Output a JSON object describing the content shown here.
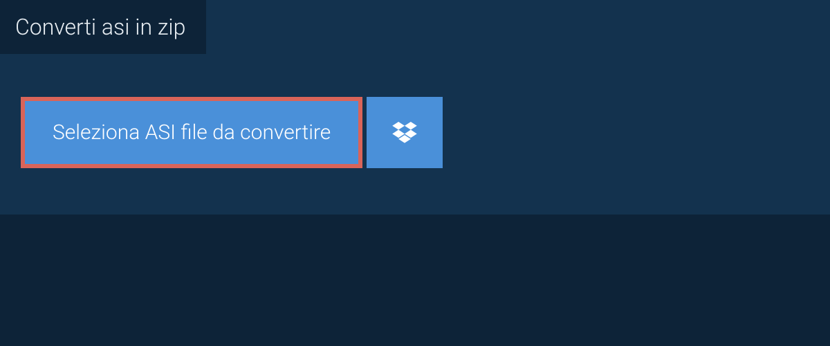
{
  "tab": {
    "label": "Converti asi in zip"
  },
  "actions": {
    "select_file_label": "Seleziona ASI file da convertire"
  }
}
